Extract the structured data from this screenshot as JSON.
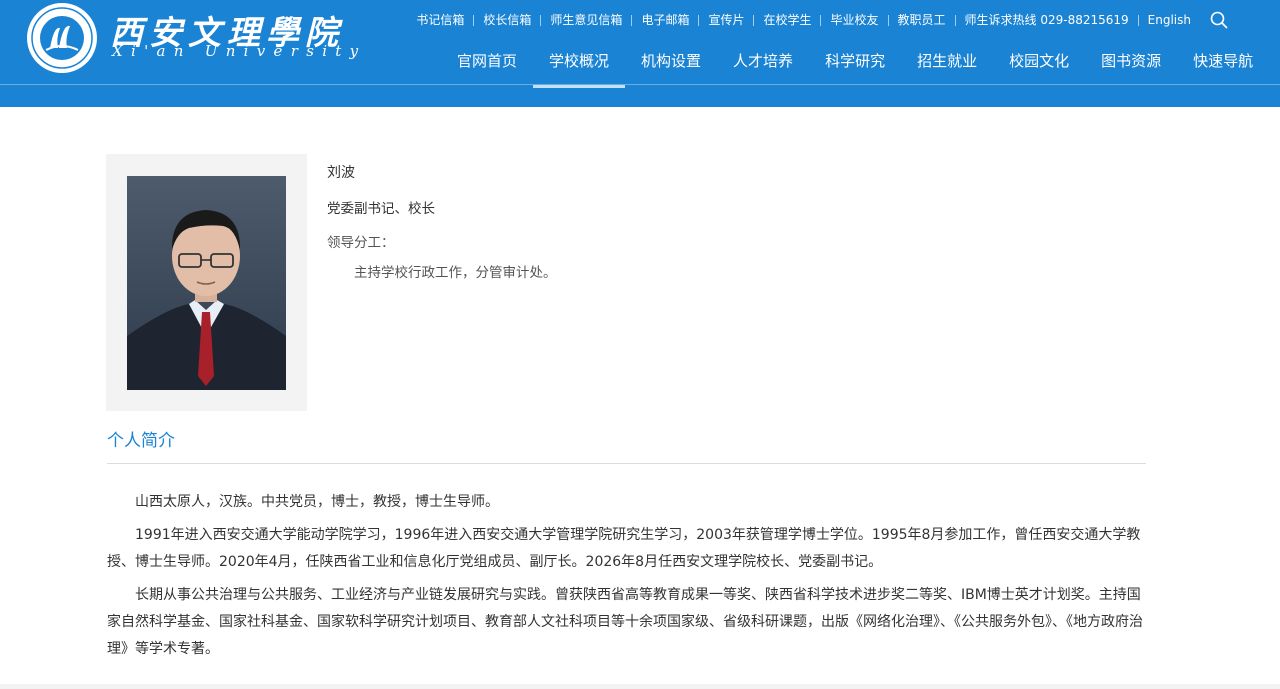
{
  "header": {
    "logo_cn": "西安文理學院",
    "logo_en": "Xi'an University",
    "logo_ring_text": "XI'AN UNIVERSITY",
    "brand_color": "#1a83d4",
    "top_links": [
      "书记信箱",
      "校长信箱",
      "师生意见信箱",
      "电子邮箱",
      "宣传片",
      "在校学生",
      "毕业校友",
      "教职员工",
      "师生诉求热线 029-88215619",
      "English"
    ],
    "search_icon": "search-icon",
    "nav": [
      {
        "label": "官网首页",
        "active": false
      },
      {
        "label": "学校概况",
        "active": true
      },
      {
        "label": "机构设置",
        "active": false
      },
      {
        "label": "人才培养",
        "active": false
      },
      {
        "label": "科学研究",
        "active": false
      },
      {
        "label": "招生就业",
        "active": false
      },
      {
        "label": "校园文化",
        "active": false
      },
      {
        "label": "图书资源",
        "active": false
      },
      {
        "label": "快速导航",
        "active": false
      }
    ]
  },
  "profile": {
    "name": "刘波",
    "title": "党委副书记、校长",
    "duty_label": "领导分工：",
    "duty_text": "主持学校行政工作，分管审计处。"
  },
  "bio": {
    "heading": "个人简介",
    "paragraphs": [
      "山西太原人，汉族。中共党员，博士，教授，博士生导师。",
      "1991年进入西安交通大学能动学院学习，1996年进入西安交通大学管理学院研究生学习，2003年获管理学博士学位。1995年8月参加工作，曾任西安交通大学教授、博士生导师。2020年4月，任陕西省工业和信息化厅党组成员、副厅长。2026年8月任西安文理学院校长、党委副书记。",
      "长期从事公共治理与公共服务、工业经济与产业链发展研究与实践。曾获陕西省高等教育成果一等奖、陕西省科学技术进步奖二等奖、IBM博士英才计划奖。主持国家自然科学基金、国家社科基金、国家软科学研究计划项目、教育部人文社科项目等十余项国家级、省级科研课题，出版《网络化治理》、《公共服务外包》、《地方政府治理》等学术专著。"
    ]
  }
}
